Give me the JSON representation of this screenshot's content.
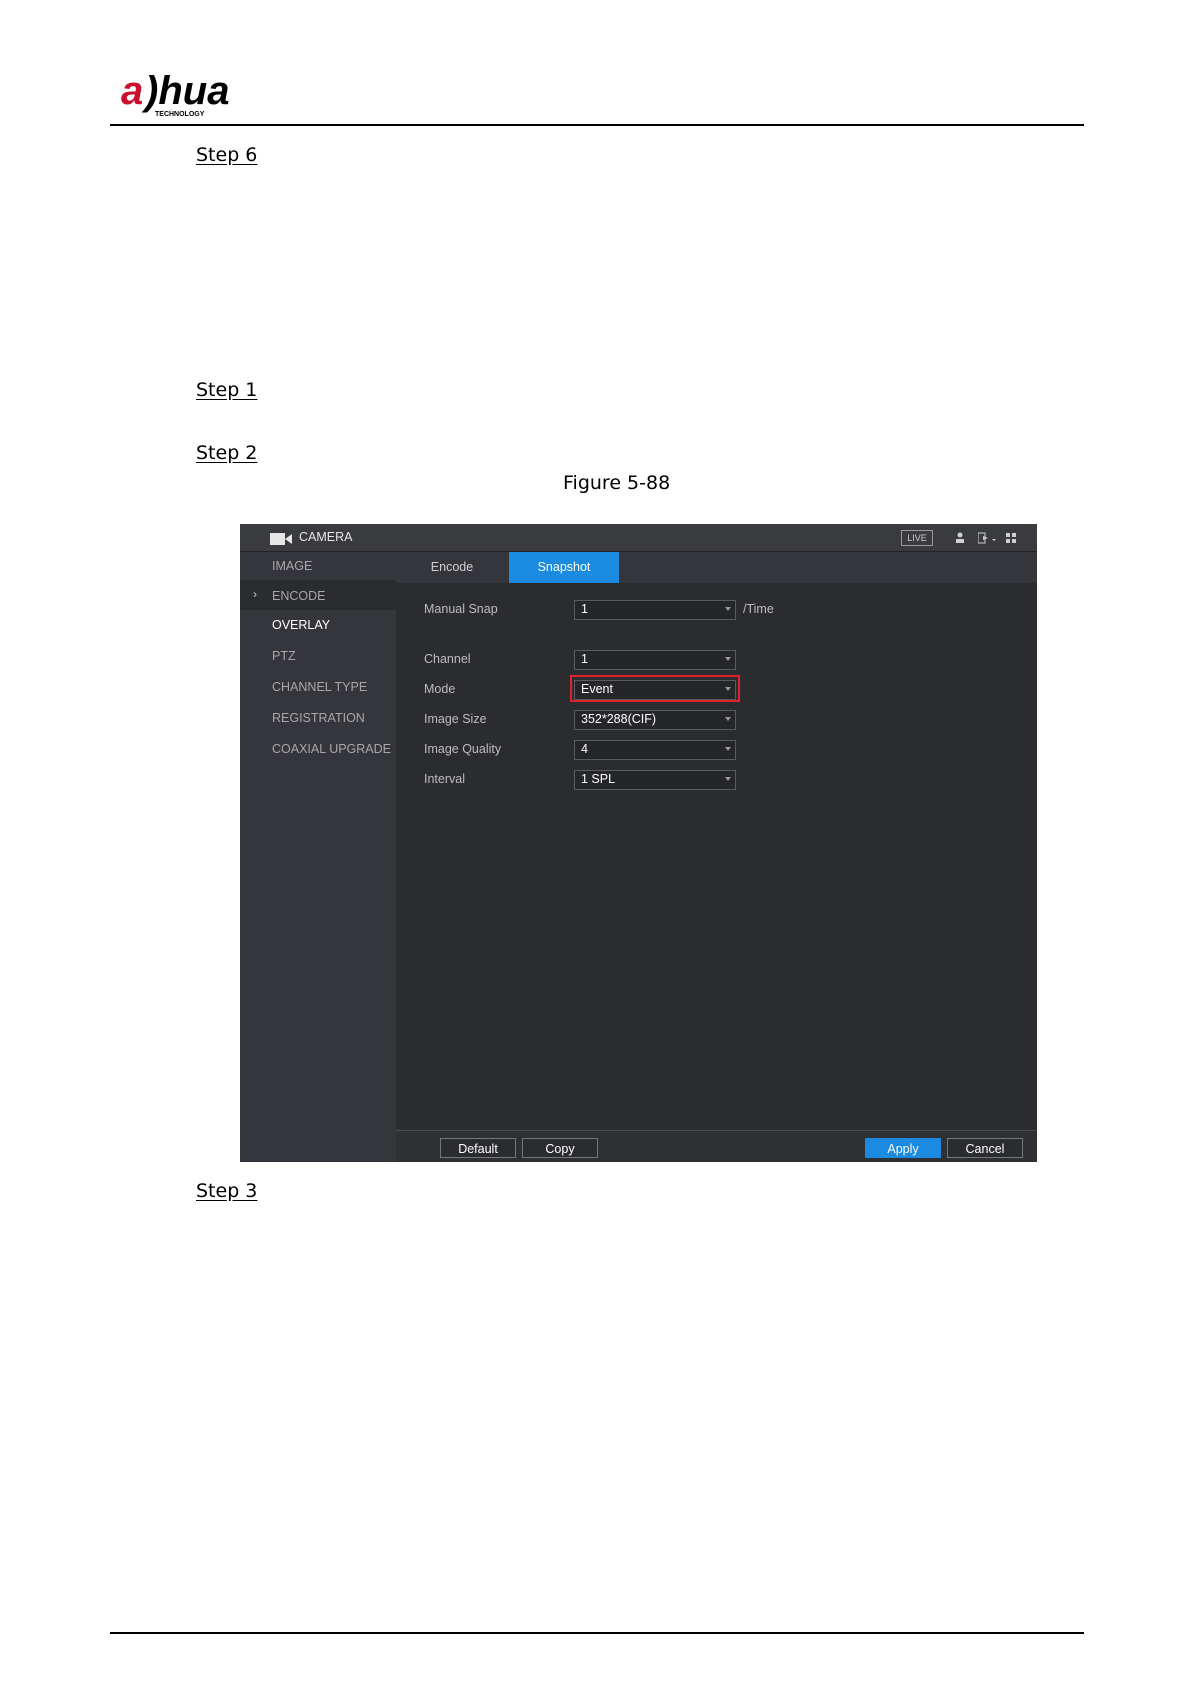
{
  "header": {
    "logo_text": "alhua",
    "logo_subtext": "TECHNOLOGY"
  },
  "steps": {
    "step6": "Step 6",
    "step1": "Step 1",
    "step2": "Step 2",
    "step3": "Step 3"
  },
  "figure_caption": "Figure 5-88",
  "app": {
    "title": "CAMERA",
    "live_badge": "LIVE",
    "icons": [
      "camera-icon",
      "user-icon",
      "logout-icon",
      "grid-icon"
    ],
    "sidebar": [
      {
        "label": "IMAGE",
        "active": false
      },
      {
        "label": "ENCODE",
        "active": false,
        "selected": true
      },
      {
        "label": "OVERLAY",
        "active": true
      },
      {
        "label": "PTZ",
        "active": false
      },
      {
        "label": "CHANNEL TYPE",
        "active": false
      },
      {
        "label": "REGISTRATION",
        "active": false
      },
      {
        "label": "COAXIAL UPGRADE",
        "active": false
      }
    ],
    "tabs": [
      {
        "label": "Encode",
        "selected": false
      },
      {
        "label": "Snapshot",
        "selected": true
      }
    ],
    "form": {
      "manual_snap_label": "Manual Snap",
      "manual_snap_value": "1",
      "manual_snap_unit": "/Time",
      "channel_label": "Channel",
      "channel_value": "1",
      "mode_label": "Mode",
      "mode_value": "Event",
      "image_size_label": "Image Size",
      "image_size_value": "352*288(CIF)",
      "image_quality_label": "Image Quality",
      "image_quality_value": "4",
      "interval_label": "Interval",
      "interval_value": "1 SPL"
    },
    "buttons": {
      "default": "Default",
      "copy": "Copy",
      "apply": "Apply",
      "cancel": "Cancel"
    },
    "colors": {
      "accent": "#1a8be0",
      "highlight": "#e0222a",
      "background": "#2b2c30"
    }
  }
}
